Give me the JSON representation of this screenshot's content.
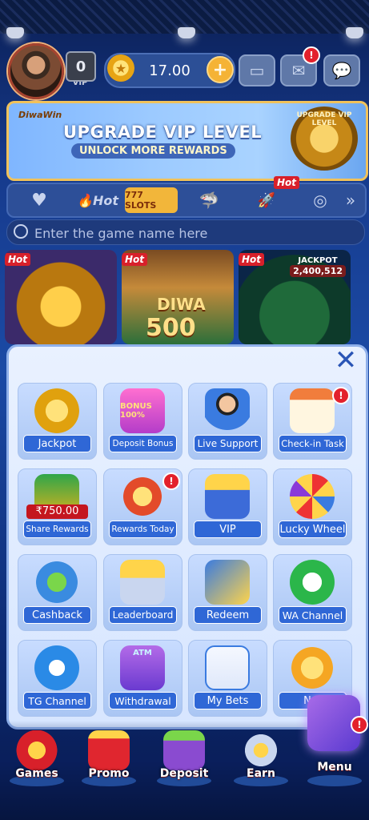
{
  "header": {
    "vip_level": "0",
    "vip_label": "VIP",
    "balance": "17.00",
    "plus": "+",
    "mail_badge": "!"
  },
  "banner": {
    "brand": "DiwaWin",
    "title": "UPGRADE VIP LEVEL",
    "subtitle": "UNLOCK MORE REWARDS",
    "emblem_text": "UPGRADE VIP LEVEL"
  },
  "tabs": [
    {
      "label": "♥",
      "icon": "heart-icon"
    },
    {
      "label": "Hot",
      "icon": "flame-icon"
    },
    {
      "label": "777 SLOTS",
      "icon": "slots-icon",
      "selected": true
    },
    {
      "label": "",
      "icon": "shark-icon"
    },
    {
      "label": "",
      "icon": "rocket-icon",
      "badge": "Hot"
    },
    {
      "label": "",
      "icon": "poker-chip-icon"
    },
    {
      "label": "»",
      "icon": "chevron-right-icon"
    }
  ],
  "search": {
    "placeholder": "Enter the game name here"
  },
  "games": [
    {
      "name": "golden-god-game",
      "badge": "Hot"
    },
    {
      "name": "DIWA 500",
      "badge": "Hot",
      "title": "DIWA",
      "number": "500"
    },
    {
      "name": "jackpot-game",
      "badge": "Hot",
      "jackpot_label": "JACKPOT",
      "jackpot_value": "2,400,512"
    }
  ],
  "menu": {
    "close": "✕",
    "items": [
      {
        "label": "Jackpot",
        "icon": "trophy-icon"
      },
      {
        "label": "Deposit Bonus",
        "icon": "gift-bonus-icon",
        "art": "BONUS 100%"
      },
      {
        "label": "Live Support",
        "icon": "support-agent-icon"
      },
      {
        "label": "Check-in Task",
        "icon": "calendar-check-icon",
        "badge": "!"
      },
      {
        "label": "Share Rewards",
        "icon": "treasure-chest-icon",
        "art": "₹750.00"
      },
      {
        "label": "Rewards Today",
        "icon": "megaphone-gift-icon",
        "badge": "!"
      },
      {
        "label": "VIP",
        "icon": "crown-throne-icon"
      },
      {
        "label": "Lucky Wheel",
        "icon": "lucky-wheel-icon"
      },
      {
        "label": "Cashback",
        "icon": "cashback-icon"
      },
      {
        "label": "Leaderboard",
        "icon": "podium-icon"
      },
      {
        "label": "Redeem",
        "icon": "ticket-icon"
      },
      {
        "label": "WA Channel",
        "icon": "whatsapp-icon"
      },
      {
        "label": "TG Channel",
        "icon": "telegram-icon"
      },
      {
        "label": "Withdrawal",
        "icon": "atm-icon",
        "art": "ATM"
      },
      {
        "label": "My Bets",
        "icon": "notepad-icon"
      },
      {
        "label": "Not",
        "icon": "notification-icon"
      }
    ]
  },
  "nav": [
    {
      "label": "Games",
      "icon": "slot-machine-icon"
    },
    {
      "label": "Promo",
      "icon": "gift-box-icon"
    },
    {
      "label": "Deposit",
      "icon": "wallet-icon"
    },
    {
      "label": "Earn",
      "icon": "phone-coins-icon"
    },
    {
      "label": "Menu",
      "icon": "menu-grid-icon",
      "badge": "!"
    }
  ],
  "colors": {
    "accent": "#2f67d6",
    "gold": "#f2b63a",
    "badge_red": "#e3212c"
  }
}
